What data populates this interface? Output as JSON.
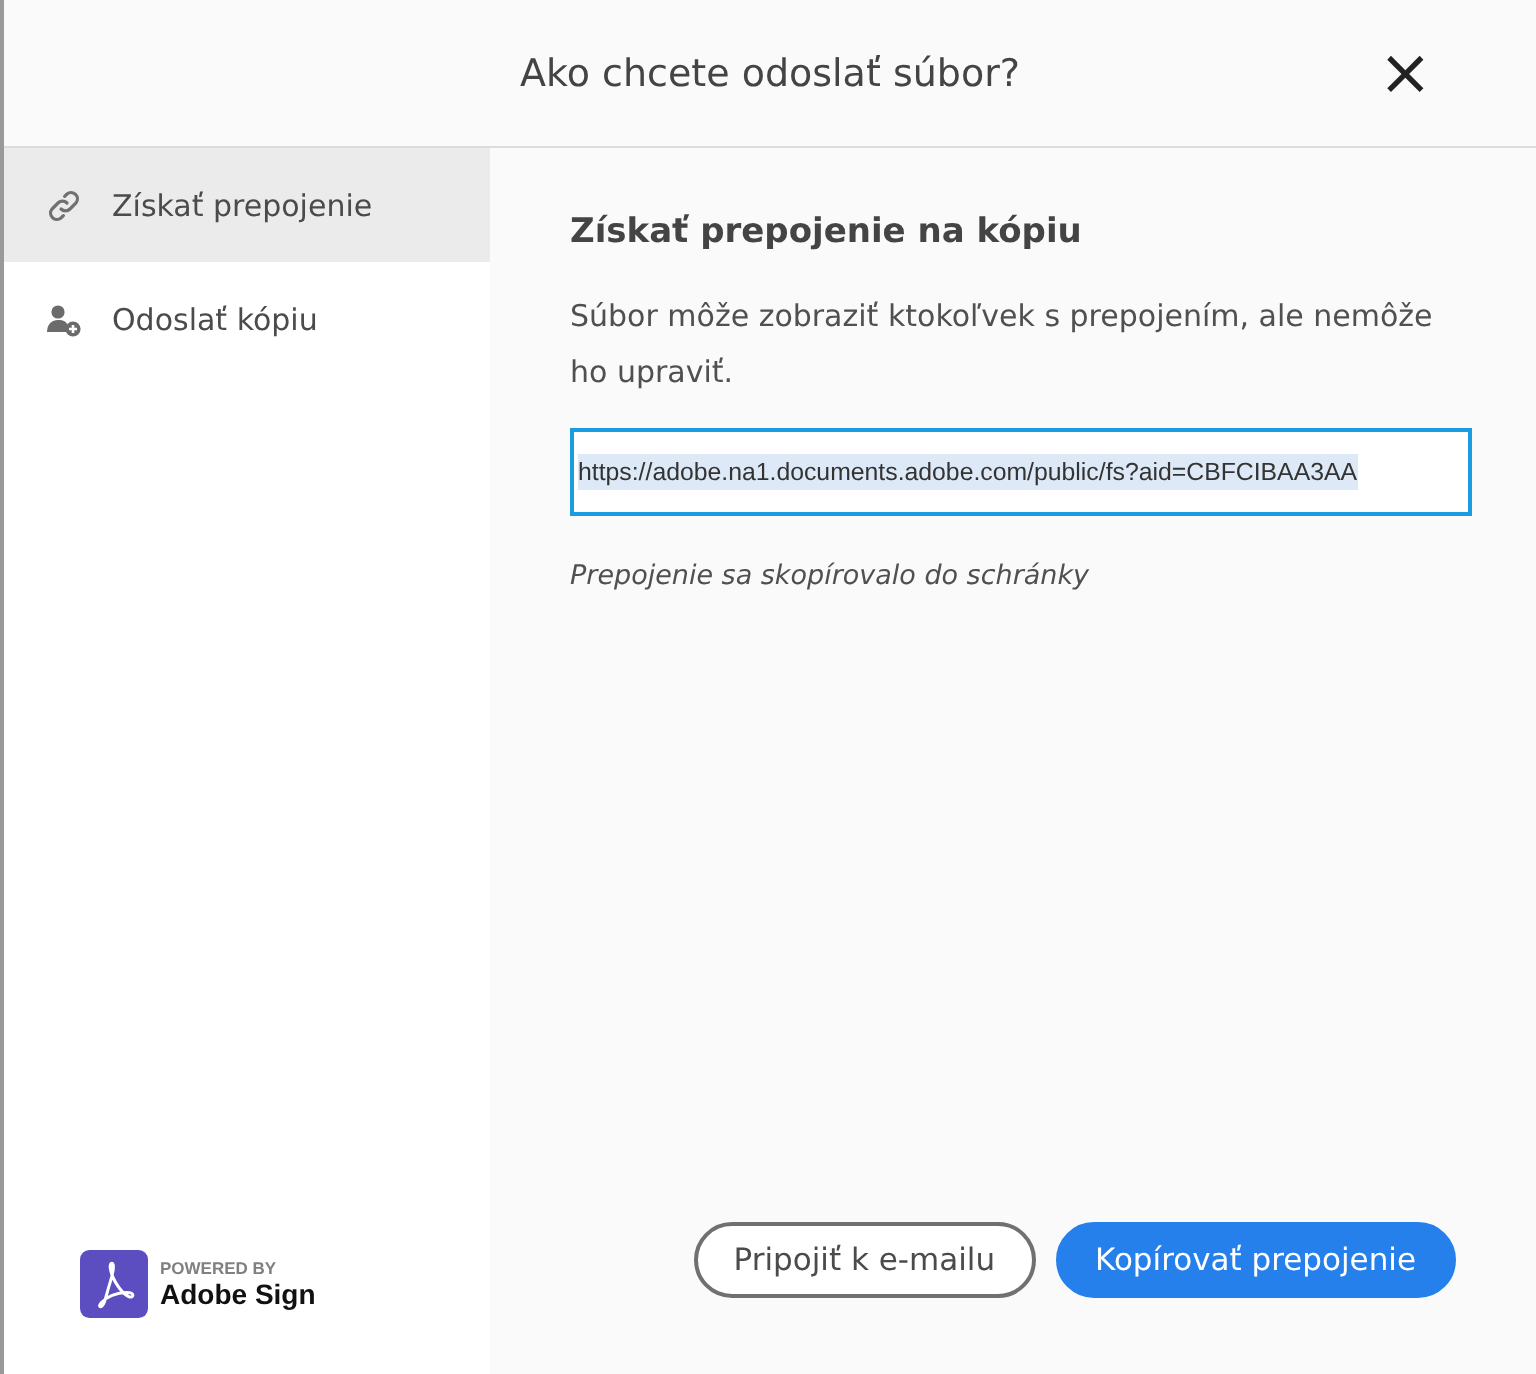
{
  "dialog": {
    "title": "Ako chcete odoslať súbor?",
    "close": "×"
  },
  "sidebar": {
    "items": [
      {
        "kind": "link",
        "label": "Získať prepojenie",
        "selected": true
      },
      {
        "kind": "person",
        "label": "Odoslať kópiu",
        "selected": false
      }
    ],
    "branding": {
      "caption": "POWERED BY",
      "product": "Adobe Sign"
    }
  },
  "content": {
    "heading": "Získať prepojenie na kópiu",
    "description": "Súbor môže zobraziť ktokoľvek s prepojením, ale nemôže ho upraviť.",
    "link_field": {
      "value": "https://adobe.na1.documents.adobe.com/public/fs?aid=CBFCIBAA3AA",
      "text_selected": true
    },
    "status": "Prepojenie sa skopírovalo do schránky"
  },
  "buttons": [
    {
      "kind": "secondary",
      "label": "Pripojiť k e-mailu"
    },
    {
      "kind": "primary",
      "label": "Kopírovať prepojenie"
    }
  ]
}
